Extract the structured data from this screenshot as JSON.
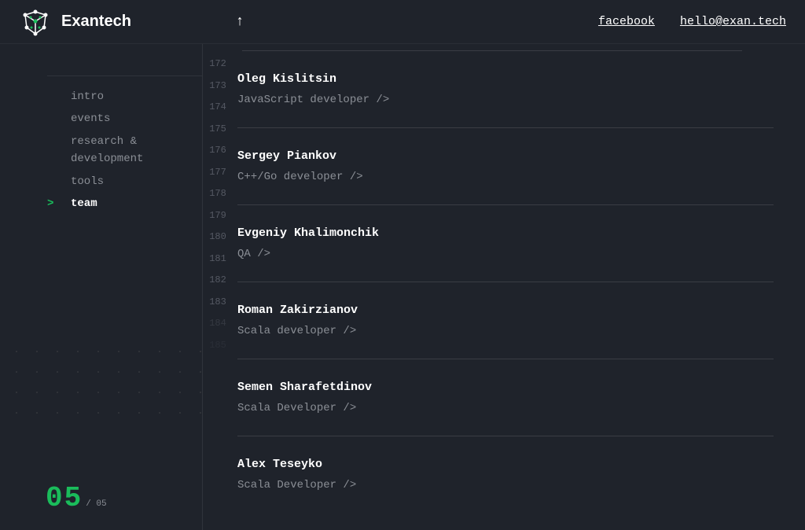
{
  "brand": "Exantech",
  "header": {
    "links": [
      {
        "label": "facebook"
      },
      {
        "label": "hello@exan.tech"
      }
    ]
  },
  "nav": {
    "items": [
      {
        "label": "intro",
        "active": false
      },
      {
        "label": "events",
        "active": false
      },
      {
        "label": "research & development",
        "active": false
      },
      {
        "label": "tools",
        "active": false
      },
      {
        "label": "team",
        "active": true
      }
    ]
  },
  "pager": {
    "current": "05",
    "total": "/ 05"
  },
  "line_numbers": [
    "172",
    "173",
    "174",
    "175",
    "176",
    "177",
    "178",
    "179",
    "180",
    "181",
    "182",
    "183",
    "184",
    "185"
  ],
  "team": [
    {
      "name": "Oleg Kislitsin",
      "role": "JavaScript developer />"
    },
    {
      "name": "Sergey Piankov",
      "role": "C++/Go developer />"
    },
    {
      "name": "Evgeniy Khalimonchik",
      "role": "QA />"
    },
    {
      "name": "Roman Zakirzianov",
      "role": "Scala developer />"
    },
    {
      "name": "Semen Sharafetdinov",
      "role": "Scala Developer />"
    },
    {
      "name": "Alex Teseyko",
      "role": "Scala Developer />"
    }
  ]
}
